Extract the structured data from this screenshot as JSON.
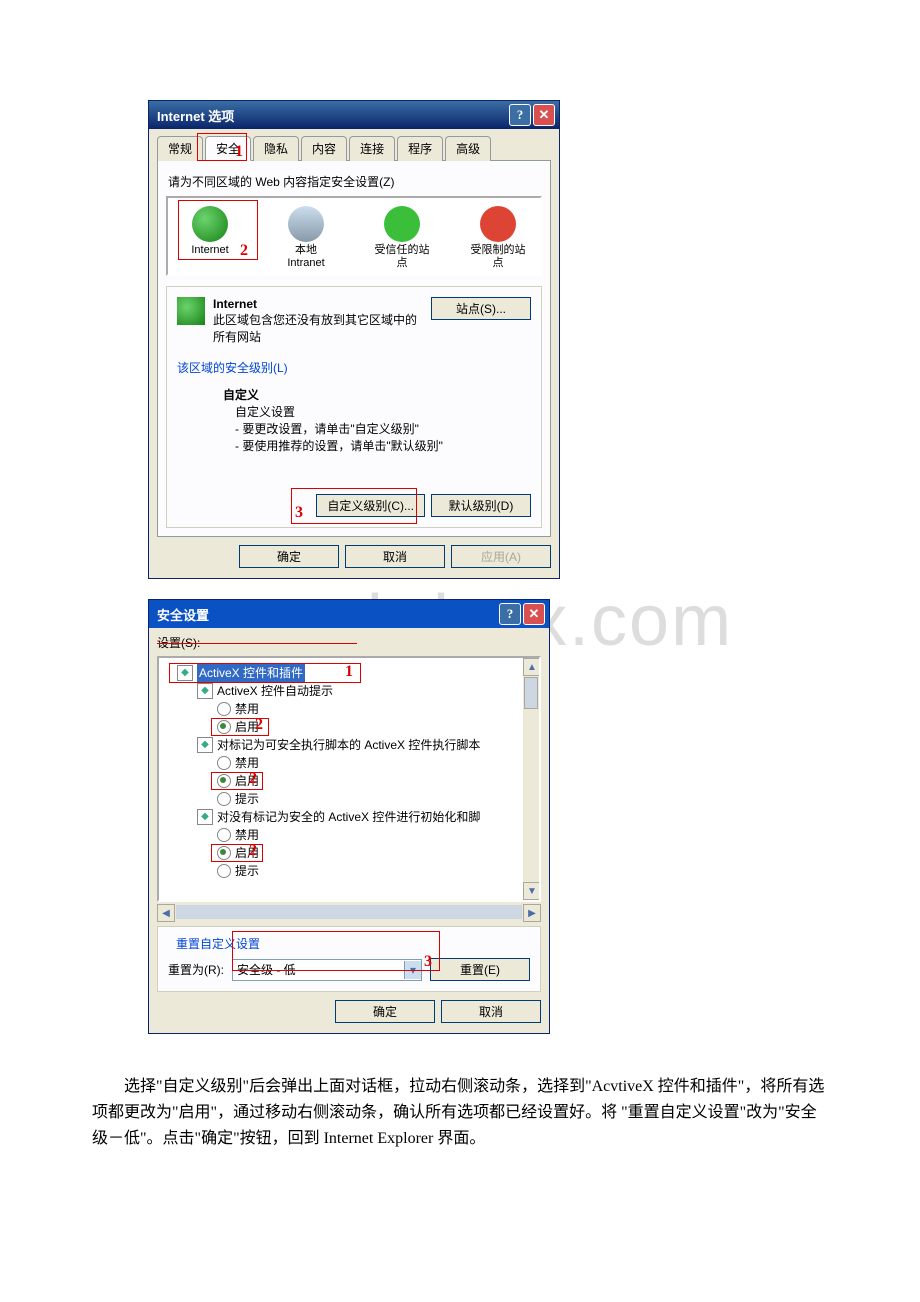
{
  "watermark": "www.bdocx.com",
  "dlg1": {
    "title": "Internet 选项",
    "tabs": [
      "常规",
      "安全",
      "隐私",
      "内容",
      "连接",
      "程序",
      "高级"
    ],
    "zone_label": "请为不同区域的 Web 内容指定安全设置(Z)",
    "zones": [
      {
        "name": "Internet"
      },
      {
        "name": "本地\nIntranet"
      },
      {
        "name": "受信任的站点"
      },
      {
        "name": "受限制的站点"
      }
    ],
    "group_title": "Internet",
    "group_desc": "此区域包含您还没有放到其它区域中的所有网站",
    "sites_btn": "站点(S)...",
    "level_label": "该区域的安全级别(L)",
    "custom_heading": "自定义",
    "custom_sub": "自定义设置",
    "custom_line1": "- 要更改设置，请单击\"自定义级别\"",
    "custom_line2": "- 要使用推荐的设置，请单击\"默认级别\"",
    "custom_level_btn": "自定义级别(C)...",
    "default_level_btn": "默认级别(D)",
    "ok": "确定",
    "cancel": "取消",
    "apply": "应用(A)"
  },
  "dlg2": {
    "title": "安全设置",
    "settings_label": "设置(S):",
    "nodes": {
      "root": "ActiveX 控件和插件",
      "n1": "ActiveX 控件自动提示",
      "n2": "对标记为可安全执行脚本的 ActiveX 控件执行脚本",
      "n3": "对没有标记为安全的 ActiveX 控件进行初始化和脚",
      "disable": "禁用",
      "enable": "启用",
      "prompt": "提示"
    },
    "reset_group": "重置自定义设置",
    "reset_to": "重置为(R):",
    "reset_val": "安全级 - 低",
    "reset_btn": "重置(E)",
    "ok": "确定",
    "cancel": "取消"
  },
  "annotations": {
    "n1": "1",
    "n2": "2",
    "n3": "3"
  },
  "paragraph": "选择\"自定义级别\"后会弹出上面对话框，拉动右侧滚动条，选择到\"AcvtiveX 控件和插件\"，将所有选项都更改为\"启用\"，通过移动右侧滚动条，确认所有选项都已经设置好。将 \"重置自定义设置\"改为\"安全级－低\"。点击\"确定\"按钮，回到 Internet Explorer 界面。"
}
